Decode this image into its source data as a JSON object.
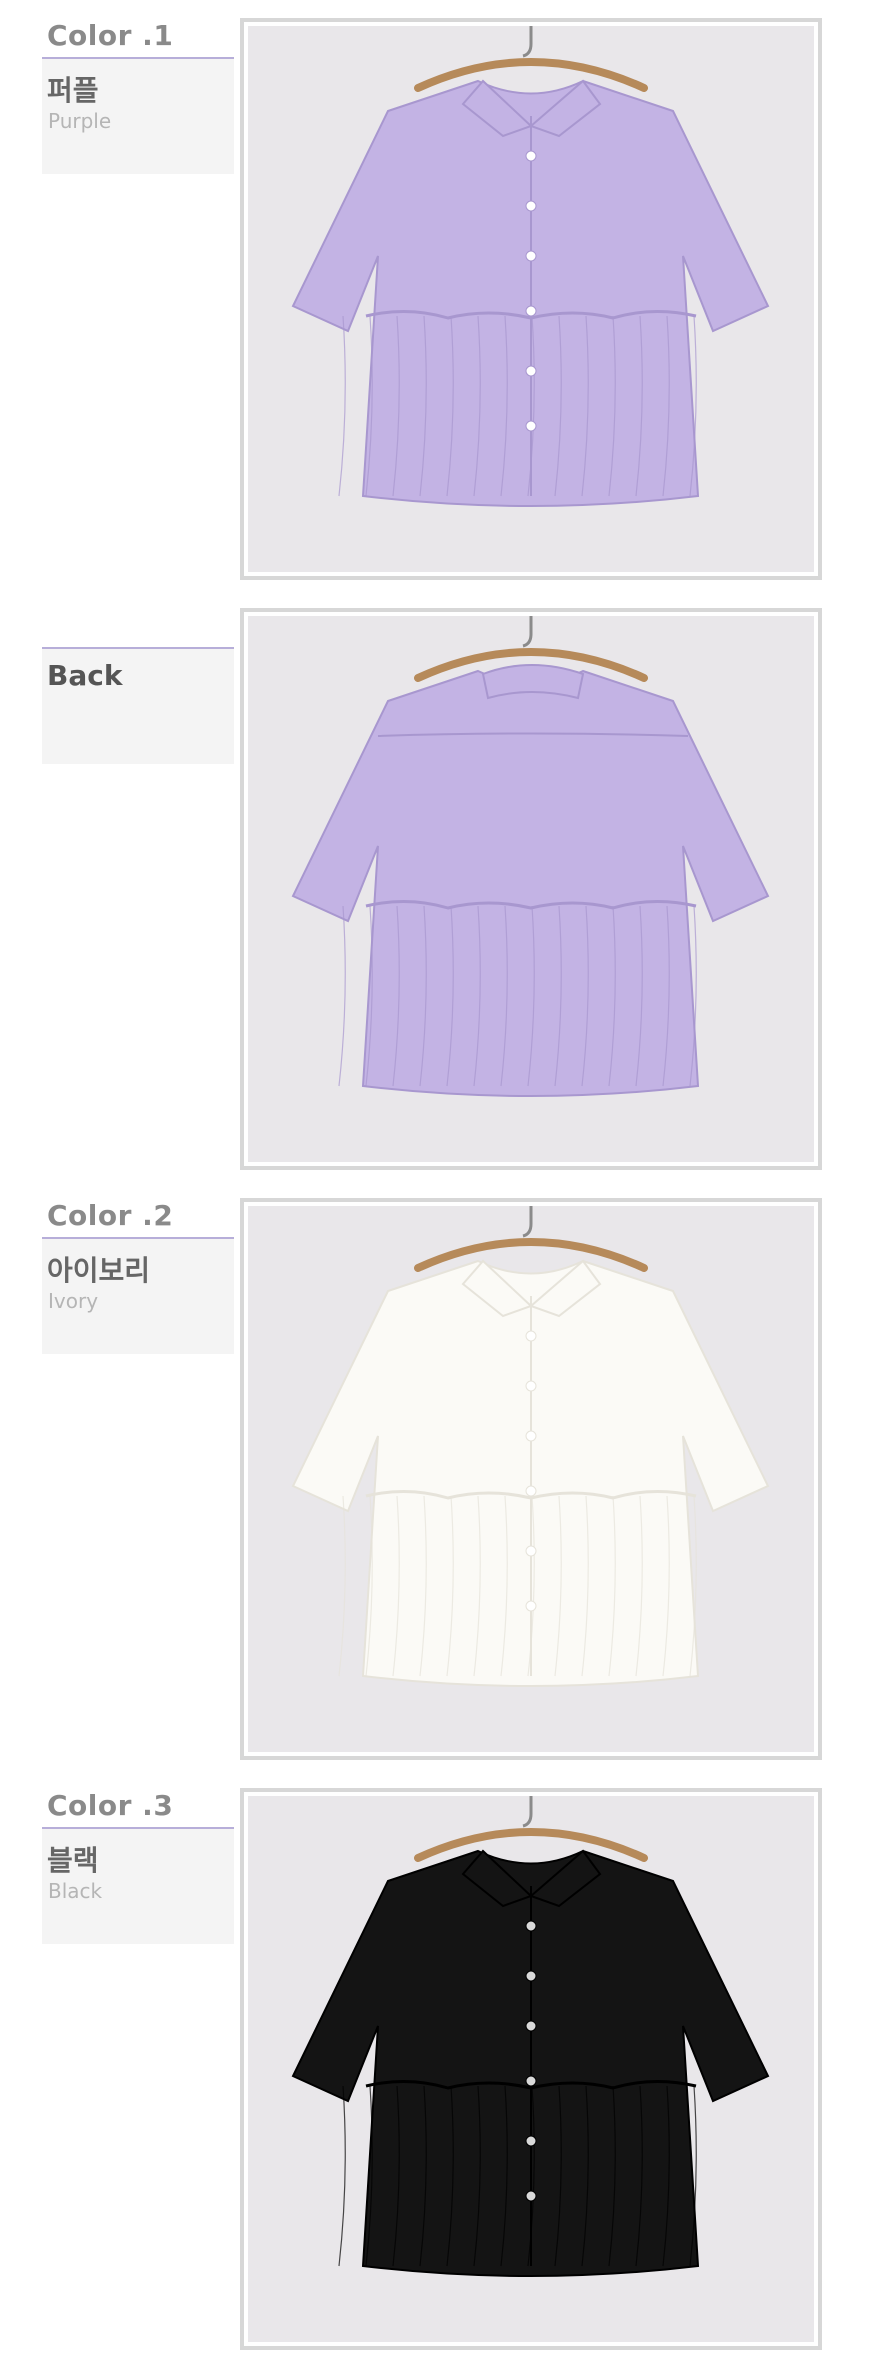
{
  "sections": [
    {
      "kind": "color",
      "heading": "Color .1",
      "name_ko": "퍼플",
      "name_en": "Purple",
      "fabric": "#c3b3e4",
      "fabric_dark": "#a897cf",
      "view": "front"
    },
    {
      "kind": "back",
      "heading": "",
      "name_ko": "Back",
      "name_en": "",
      "fabric": "#c3b3e4",
      "fabric_dark": "#a897cf",
      "view": "back"
    },
    {
      "kind": "color",
      "heading": "Color .2",
      "name_ko": "아이보리",
      "name_en": "Ivory",
      "fabric": "#fbfaf6",
      "fabric_dark": "#e6e3da",
      "view": "front"
    },
    {
      "kind": "color",
      "heading": "Color .3",
      "name_ko": "블랙",
      "name_en": "Black",
      "fabric": "#141414",
      "fabric_dark": "#000000",
      "view": "front"
    }
  ],
  "colors": {
    "accent_line": "#b7aed9",
    "photo_bg": "#e9e7ea",
    "hanger": "#b68a5a"
  }
}
